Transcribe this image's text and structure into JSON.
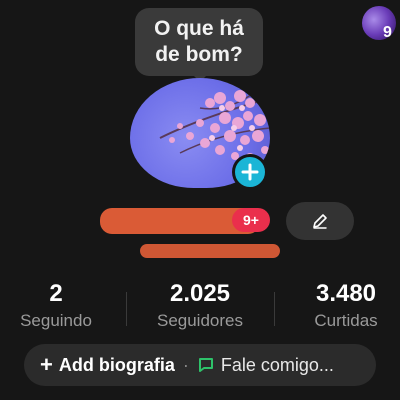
{
  "story_bubble": {
    "text": "O que há\nde bom?"
  },
  "mini_avatar": {
    "badge": "9"
  },
  "profile": {
    "notification_badge": "9+",
    "edit_icon": "pencil-icon",
    "add_icon": "plus-icon"
  },
  "stats": [
    {
      "value": "2",
      "label": "Seguindo"
    },
    {
      "value": "2.025",
      "label": "Seguidores"
    },
    {
      "value": "3.480",
      "label": "Curtidas"
    }
  ],
  "bio": {
    "add_label": "Add biografia",
    "separator": "·",
    "chat_label": "Fale comigo..."
  },
  "colors": {
    "background": "#161616",
    "accent_cyan": "#1bb5d6",
    "badge_red": "#ea2f4c",
    "chat_green": "#2ec26a",
    "redaction_orange": "#f0633a"
  }
}
